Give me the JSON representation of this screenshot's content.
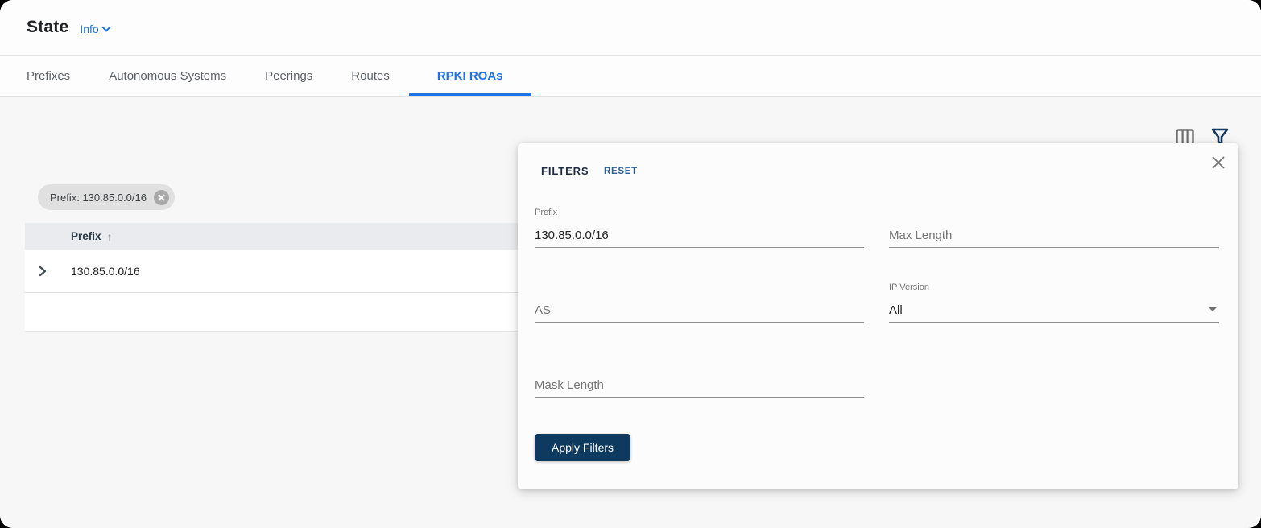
{
  "header": {
    "title": "State",
    "info_label": "Info"
  },
  "tabs": [
    {
      "label": "Prefixes",
      "active": false
    },
    {
      "label": "Autonomous Systems",
      "active": false
    },
    {
      "label": "Peerings",
      "active": false
    },
    {
      "label": "Routes",
      "active": false
    },
    {
      "label": "RPKI ROAs",
      "active": true
    }
  ],
  "toolbar": {
    "columns_icon": "view-columns",
    "filter_icon": "filter-funnel"
  },
  "filter_chip": {
    "label": "Prefix: 130.85.0.0/16",
    "remove_icon": "close-circle",
    "remove_glyph": "✕"
  },
  "table": {
    "columns": [
      {
        "label": "Prefix",
        "sort": "asc",
        "sort_glyph": "↑"
      }
    ],
    "rows": [
      {
        "prefix": "130.85.0.0/16",
        "expand_icon": "chevron-right"
      }
    ]
  },
  "filters_panel": {
    "title": "FILTERS",
    "reset_label": "RESET",
    "close_icon": "close",
    "fields": {
      "prefix": {
        "label": "Prefix",
        "value": "130.85.0.0/16"
      },
      "max_length": {
        "placeholder": "Max Length",
        "value": ""
      },
      "as": {
        "placeholder": "AS",
        "value": ""
      },
      "ip_version": {
        "label": "IP Version",
        "value": "All"
      },
      "mask_length": {
        "placeholder": "Mask Length",
        "value": ""
      }
    },
    "apply_label": "Apply Filters"
  },
  "colors": {
    "accent_blue": "#1a73e8",
    "navy_button": "#0d3a5e",
    "panel_bg": "#fcfcfc",
    "content_bg": "#f7f7f7",
    "table_header_bg": "#e9ebee",
    "chip_bg": "#e0e0e0"
  }
}
